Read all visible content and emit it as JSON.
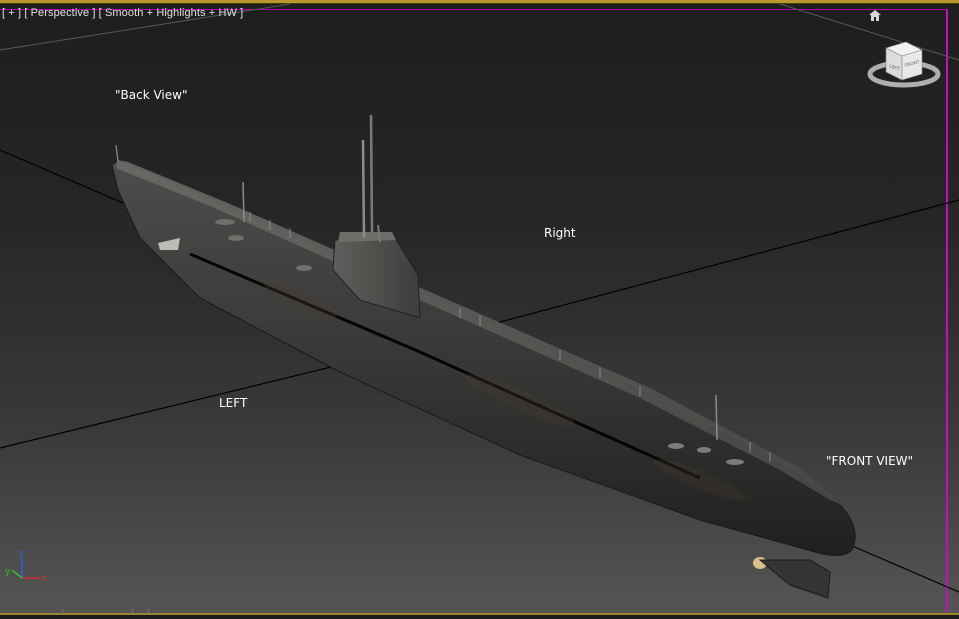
{
  "viewport": {
    "label_plus": "[ + ]",
    "label_view": "[ Perspective ]",
    "label_shading": "[ Smooth + Highlights + HW ]"
  },
  "viewcube": {
    "left_face": "LEFT",
    "front_face": "FRONT"
  },
  "annotations": {
    "back_view": "\"Back View\"",
    "right": "Right",
    "left": "LEFT",
    "front_view": "\"FRONT VIEW\""
  },
  "axis": {
    "x": "x",
    "y": "y",
    "z": "z"
  },
  "colors": {
    "viewport_border_active": "#b79a2e",
    "safe_frame": "#c010c0",
    "axis_x": "#d03030",
    "axis_y": "#30c030",
    "axis_z": "#3060e0",
    "annotation_text": "#ffffff"
  }
}
